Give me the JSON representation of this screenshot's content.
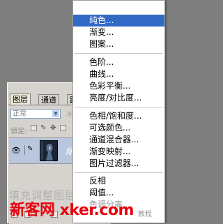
{
  "layers_panel": {
    "tabs": [
      {
        "label": "图层"
      },
      {
        "label": "通道"
      },
      {
        "label": "路径"
      }
    ],
    "blend_mode": "正常",
    "opacity_label": "不透",
    "lock_label": "锁定:",
    "layer": {
      "name": "背景"
    },
    "ghost_text": "填充调整图层"
  },
  "menu": {
    "items": [
      {
        "label": "纯色...",
        "highlight": true
      },
      {
        "label": "渐变..."
      },
      {
        "label": "图案..."
      },
      {
        "label": "色阶..."
      },
      {
        "label": "曲线..."
      },
      {
        "label": "色彩平衡..."
      },
      {
        "label": "亮度/对比度..."
      },
      {
        "label": "色相/饱和度..."
      },
      {
        "label": "可选颜色..."
      },
      {
        "label": "通道混合器..."
      },
      {
        "label": "渐变映射..."
      },
      {
        "label": "图片过滤器..."
      },
      {
        "label": "反相"
      },
      {
        "label": "阈值..."
      },
      {
        "label": "色调分离..."
      }
    ]
  },
  "watermark": "新客网 xker.com",
  "site_mark": "教程",
  "colors": {
    "highlight": "#316ac5",
    "watermark": "#e8000f"
  }
}
